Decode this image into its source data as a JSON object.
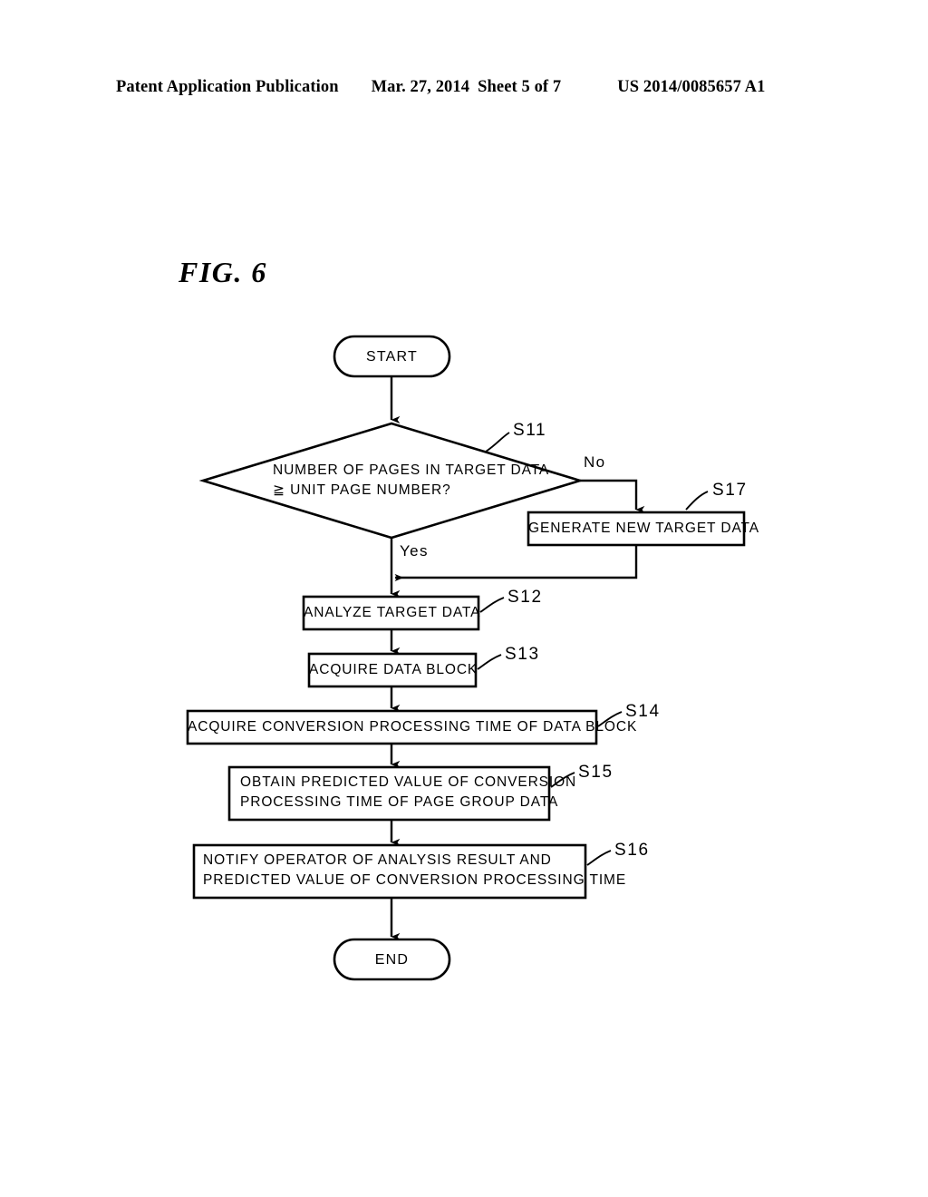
{
  "header": {
    "publication": "Patent Application Publication",
    "date": "Mar. 27, 2014",
    "sheet": "Sheet 5 of 7",
    "document_number": "US 2014/0085657 A1"
  },
  "figure": {
    "label": "FIG. 6"
  },
  "flowchart": {
    "start": {
      "text": "START"
    },
    "end": {
      "text": "END"
    },
    "decision": {
      "step": "S11",
      "line1": "NUMBER OF PAGES IN TARGET DATA",
      "line2": "≧ UNIT PAGE NUMBER?",
      "yes_label": "Yes",
      "no_label": "No"
    },
    "steps": [
      {
        "step": "S17",
        "line1": "GENERATE NEW TARGET DATA",
        "line2": ""
      },
      {
        "step": "S12",
        "line1": "ANALYZE TARGET DATA",
        "line2": ""
      },
      {
        "step": "S13",
        "line1": "ACQUIRE DATA BLOCK",
        "line2": ""
      },
      {
        "step": "S14",
        "line1": "ACQUIRE CONVERSION PROCESSING TIME OF DATA BLOCK",
        "line2": ""
      },
      {
        "step": "S15",
        "line1": "OBTAIN PREDICTED VALUE OF CONVERSION",
        "line2": "PROCESSING TIME OF PAGE GROUP DATA"
      },
      {
        "step": "S16",
        "line1": "NOTIFY OPERATOR OF ANALYSIS RESULT AND",
        "line2": "PREDICTED VALUE OF CONVERSION PROCESSING TIME"
      }
    ]
  },
  "colors": {
    "background": "#ffffff",
    "ink": "#000000"
  }
}
